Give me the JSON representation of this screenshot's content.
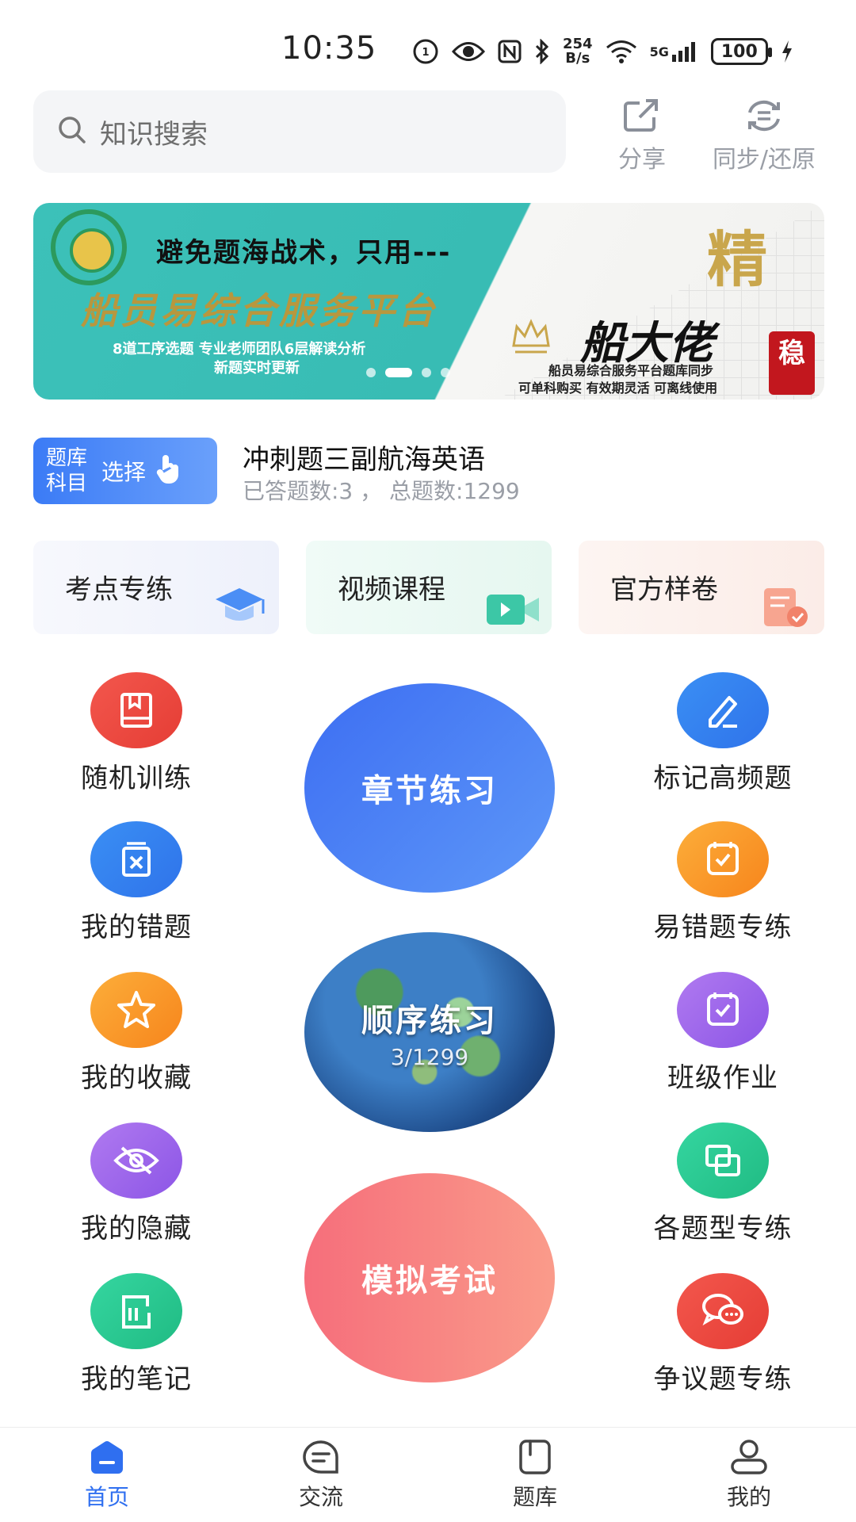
{
  "status_bar": {
    "time": "10:35",
    "net_speed_value": "254",
    "net_speed_unit": "B/s",
    "battery": "100",
    "network": "5G"
  },
  "search": {
    "placeholder": "知识搜索"
  },
  "top_actions": {
    "share": "分享",
    "sync": "同步/还原"
  },
  "banner": {
    "headline": "避免题海战术，只用---",
    "platform": "船员易综合服务平台",
    "sub1": "8道工序选题 专业老师团队6层解读分析",
    "sub2": "新题实时更新",
    "jing": "精",
    "brand": "船大佬",
    "slogan1": "船员易综合服务平台题库同步",
    "slogan2": "可单科购买 有效期灵活 可离线使用",
    "seal": "稳",
    "active_slide": 2,
    "slide_count": 4
  },
  "subject": {
    "chip_line1": "题库",
    "chip_line2": "科目",
    "chip_select": "选择",
    "title": "冲刺题三副航海英语",
    "stats": "已答题数:3 ， 总题数:1299"
  },
  "quick_cards": [
    {
      "label": "考点专练",
      "icon": "graduation-cap-icon"
    },
    {
      "label": "视频课程",
      "icon": "video-camera-icon"
    },
    {
      "label": "官方样卷",
      "icon": "document-check-icon"
    }
  ],
  "left_features": [
    {
      "label": "随机训练",
      "icon": "book-icon",
      "color": "#ec463d"
    },
    {
      "label": "我的错题",
      "icon": "wrong-question-icon",
      "color": "#3183ef"
    },
    {
      "label": "我的收藏",
      "icon": "star-icon",
      "color": "#f99a2b"
    },
    {
      "label": "我的隐藏",
      "icon": "eye-hidden-icon",
      "color": "#9d68eb"
    },
    {
      "label": "我的笔记",
      "icon": "note-icon",
      "color": "#28c690"
    }
  ],
  "right_features": [
    {
      "label": "标记高频题",
      "icon": "pencil-icon",
      "color": "#3183ef"
    },
    {
      "label": "易错题专练",
      "icon": "checkbox-icon",
      "color": "#f99a2b"
    },
    {
      "label": "班级作业",
      "icon": "checkbox-icon",
      "color": "#9d68eb"
    },
    {
      "label": "各题型专练",
      "icon": "layers-icon",
      "color": "#28c690"
    },
    {
      "label": "争议题专练",
      "icon": "chat-bubbles-icon",
      "color": "#ec463d"
    }
  ],
  "center": {
    "chapter": "章节练习",
    "order": "顺序练习",
    "order_progress": "3/1299",
    "exam": "模拟考试"
  },
  "bottom_nav": [
    {
      "label": "首页",
      "icon": "home-icon",
      "active": true
    },
    {
      "label": "交流",
      "icon": "message-icon",
      "active": false
    },
    {
      "label": "题库",
      "icon": "question-bank-icon",
      "active": false
    },
    {
      "label": "我的",
      "icon": "user-icon",
      "active": false
    }
  ],
  "colors": {
    "accent": "#2f6ff0",
    "muted": "#9a9ea6"
  }
}
